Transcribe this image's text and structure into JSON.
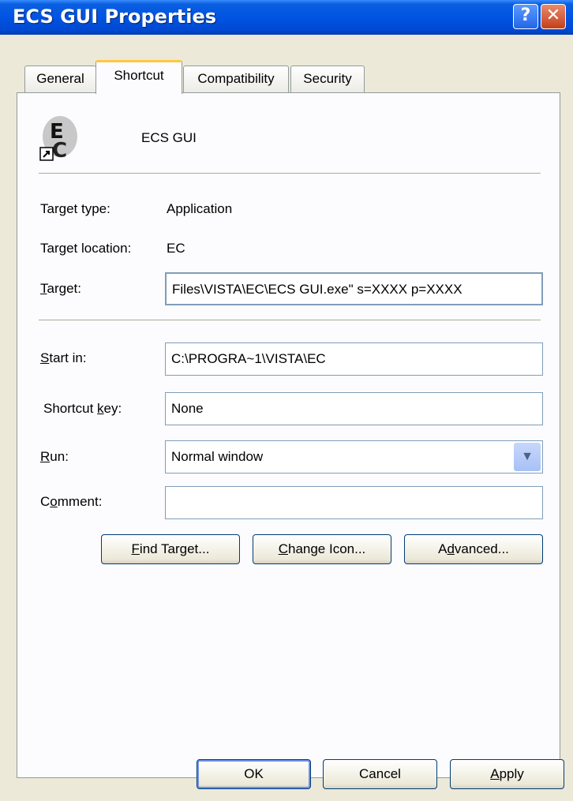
{
  "window": {
    "title": "ECS GUI Properties",
    "help_glyph": "?",
    "close_glyph": "✕"
  },
  "tabs": [
    {
      "label": "General",
      "active": false
    },
    {
      "label": "Shortcut",
      "active": true
    },
    {
      "label": "Compatibility",
      "active": false
    },
    {
      "label": "Security",
      "active": false
    }
  ],
  "shortcut": {
    "name": "ECS GUI",
    "icon": "ecs-app-icon",
    "target_type_label": "Target type:",
    "target_type": "Application",
    "target_location_label": "Target location:",
    "target_location": "EC",
    "target_label_key": "T",
    "target_label_rest": "arget:",
    "target_value": "Files\\VISTA\\EC\\ECS GUI.exe\" s=XXXX p=XXXX",
    "start_in_label_key": "S",
    "start_in_label_rest": "tart in:",
    "start_in_value": "C:\\PROGRA~1\\VISTA\\EC",
    "shortcut_key_label_pre": "Shortcut ",
    "shortcut_key_label_key": "k",
    "shortcut_key_label_rest": "ey:",
    "shortcut_key_value": "None",
    "run_label_key": "R",
    "run_label_rest": "un:",
    "run_value": "Normal window",
    "comment_label_pre": "C",
    "comment_label_key": "o",
    "comment_label_rest": "mment:",
    "comment_value": ""
  },
  "buttons": {
    "find_target_key": "F",
    "find_target_rest": "ind Target...",
    "change_icon_key": "C",
    "change_icon_rest": "hange Icon...",
    "advanced_pre": "A",
    "advanced_key": "d",
    "advanced_rest": "vanced...",
    "ok": "OK",
    "cancel": "Cancel",
    "apply_key": "A",
    "apply_rest": "pply"
  },
  "colors": {
    "titlebar": "#0054e3",
    "tab_highlight": "#ffc83c",
    "dialog_bg": "#ece9d8"
  }
}
